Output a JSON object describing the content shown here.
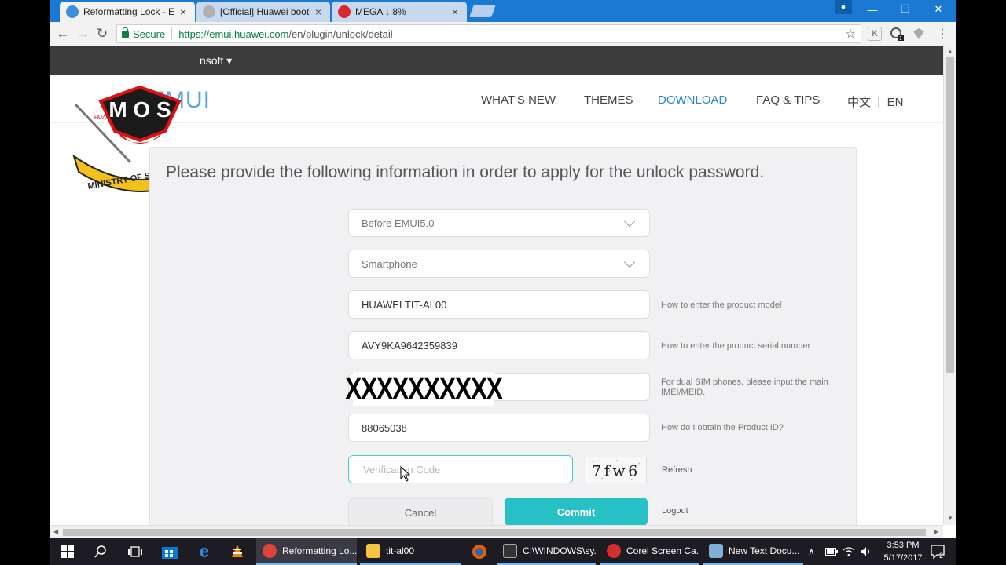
{
  "browser": {
    "tabs": [
      {
        "label": "Reformatting Lock - EMU",
        "close": "×"
      },
      {
        "label": "[Official] Huawei bootlo",
        "close": "×"
      },
      {
        "label": "MEGA ↓ 8%",
        "close": "×"
      }
    ],
    "window_controls": {
      "minimize": "—",
      "restore": "❐",
      "close": "✕"
    },
    "secure_label": "Secure",
    "url_host": "https://emui.huawei.com",
    "url_path": "/en/plugin/unlock/detail",
    "ext_badge": "1"
  },
  "site": {
    "topbar_label": "nsoft ▾",
    "logo_text": "EMUI",
    "logo_small": "HUAWEI",
    "nav": [
      "WHAT'S NEW",
      "THEMES",
      "DOWNLOAD",
      "FAQ & TIPS"
    ],
    "lang": "中文  |  EN",
    "watermark": {
      "top": "M O S",
      "ribbon": "MINISTRY OF SOLUTIONS"
    }
  },
  "form": {
    "intro": "Please provide the following information in order to apply for the unlock password.",
    "emui_version": "Before EMUI5.0",
    "device_type": "Smartphone",
    "product_model": "HUAWEI TIT-AL00",
    "serial_number": "AVY9KA9642359839",
    "imei_redacted": "XXXXXXXXXX",
    "product_id": "88065038",
    "verification_placeholder": "Verification Code",
    "captcha_text": "7fw6",
    "hints": {
      "model": "How to enter the product model",
      "serial": "How to enter the product serial number",
      "imei_line1": "For dual SIM phones, please input the main",
      "imei_line2": "IMEI/MEID.",
      "product_id": "How do I obtain the Product ID?"
    },
    "refresh": "Refresh",
    "cancel": "Cancel",
    "commit": "Commit",
    "logout": "Logout"
  },
  "taskbar": {
    "apps": [
      {
        "label": "Reformatting Lo...",
        "color": "#db4437"
      },
      {
        "label": "tit-al00",
        "color": "#f4c542"
      },
      {
        "label": "C:\\WINDOWS\\sy...",
        "color": "#333333"
      },
      {
        "label": "Corel Screen Ca...",
        "color": "#d32f2f"
      },
      {
        "label": "New Text Docu...",
        "color": "#7fb0d8"
      }
    ],
    "time": "3:53 PM",
    "date": "5/17/2017",
    "notif_count": "2"
  },
  "colors": {
    "accent": "#27c0c6",
    "nav_active": "#2a86d1",
    "chrome_blue": "#1a79d3"
  }
}
